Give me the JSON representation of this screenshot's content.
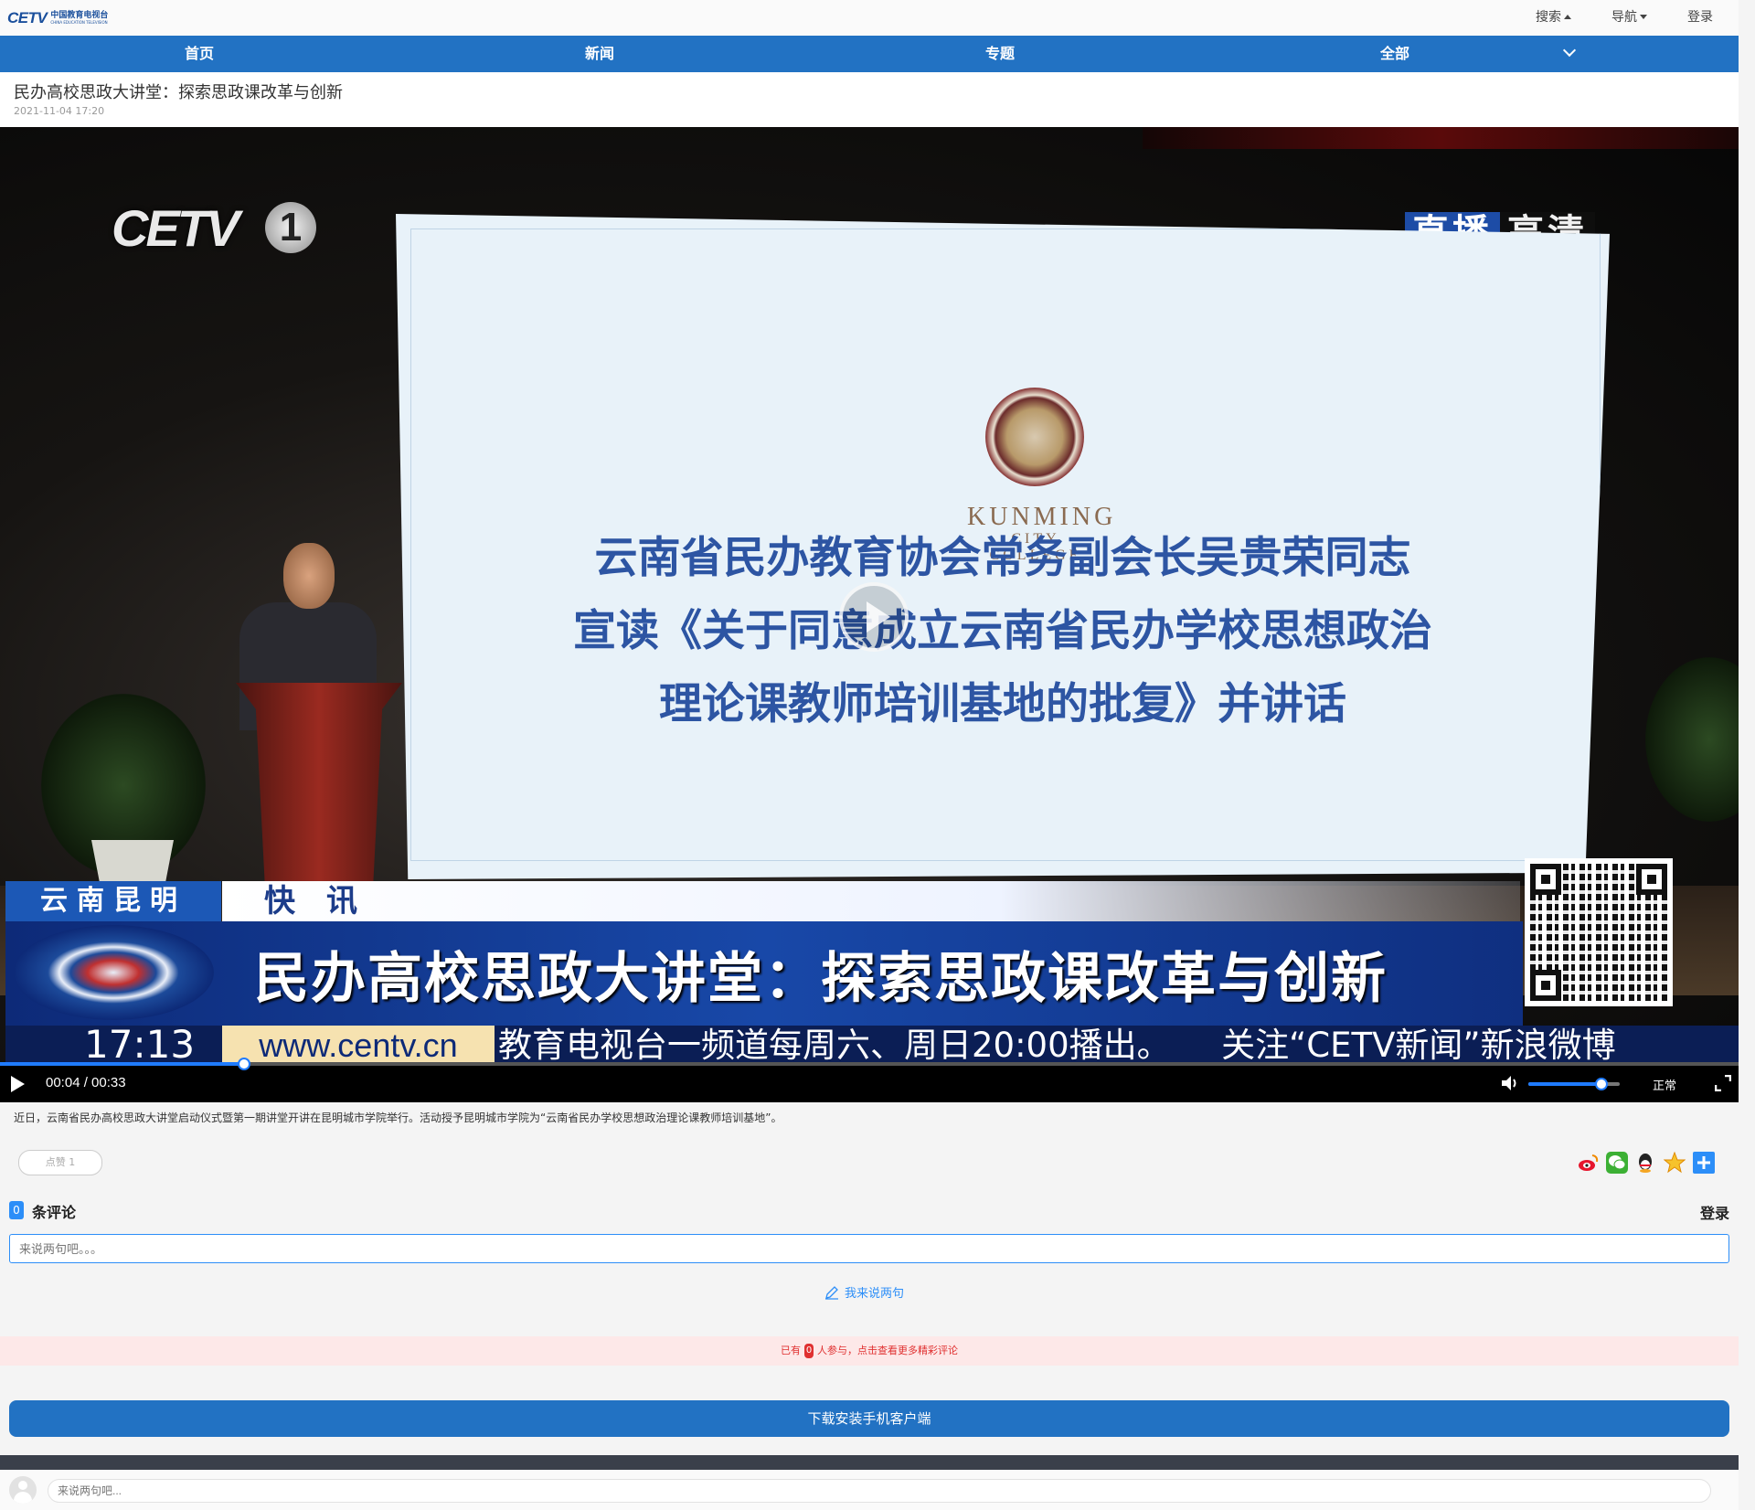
{
  "header": {
    "logo_mark": "CETV",
    "logo_cn": "中国教育电视台",
    "logo_en": "CHINA EDUCATION TELEVISION",
    "search_label": "搜索",
    "nav_label": "导航",
    "login_label": "登录"
  },
  "nav": {
    "items": [
      {
        "label": "首页"
      },
      {
        "label": "新闻"
      },
      {
        "label": "专题"
      },
      {
        "label": "全部"
      }
    ],
    "more_icon": "chevron-down-icon"
  },
  "article": {
    "title": "民办高校思政大讲堂：探索思政课改革与创新",
    "date": "2021-11-04 17:20",
    "summary": "近日，云南省民办高校思政大讲堂启动仪式暨第一期讲堂开讲在昆明城市学院举行。活动授予昆明城市学院为“云南省民办学校思想政治理论课教师培训基地”。"
  },
  "video": {
    "channel_logo": "CETV",
    "channel_number": "1",
    "badge_live": "直播",
    "badge_hd": "高清",
    "screen_college_en": "KUNMING",
    "screen_college_en2": "CITY COLLEGE",
    "screen_lines": [
      "云南省民办教育协会常务副会长吴贵荣同志",
      "宣读《关于同意成立云南省民办学校思想政治",
      "理论课教师培训基地的批复》并讲话"
    ],
    "location_tag": "云南昆明",
    "news_flash": "快讯",
    "headline": "民办高校思政大讲堂：探索思政课改革与创新",
    "clock": "17:13",
    "url": "www.centv.cn",
    "ticker": "教育电视台一频道每周六、周日20:00播出。　　关注“CETV新闻”新浪微博",
    "progress": 0.14,
    "time_display": "00:04 / 00:33",
    "volume": 0.8,
    "speed_label": "正常"
  },
  "engagement": {
    "likes_label": "点赞 1",
    "share_icons": [
      "weibo-icon",
      "wechat-icon",
      "qq-icon",
      "qzone-icon",
      "more-share-icon"
    ]
  },
  "comments": {
    "count": "0",
    "count_label": "条评论",
    "login_label": "登录",
    "input_placeholder": "来说两句吧。。。",
    "write_label": "我来说两句",
    "participation_prefix": "已有",
    "participation_count": "0",
    "participation_suffix": "人参与，点击查看更多精彩评论"
  },
  "download_label": "下载安装手机客户端",
  "bottom_bar": {
    "input_placeholder": "来说两句吧..."
  },
  "colors": {
    "nav_blue": "#2272c3",
    "accent_blue": "#2c8ef8",
    "alert_red": "#e03030"
  }
}
